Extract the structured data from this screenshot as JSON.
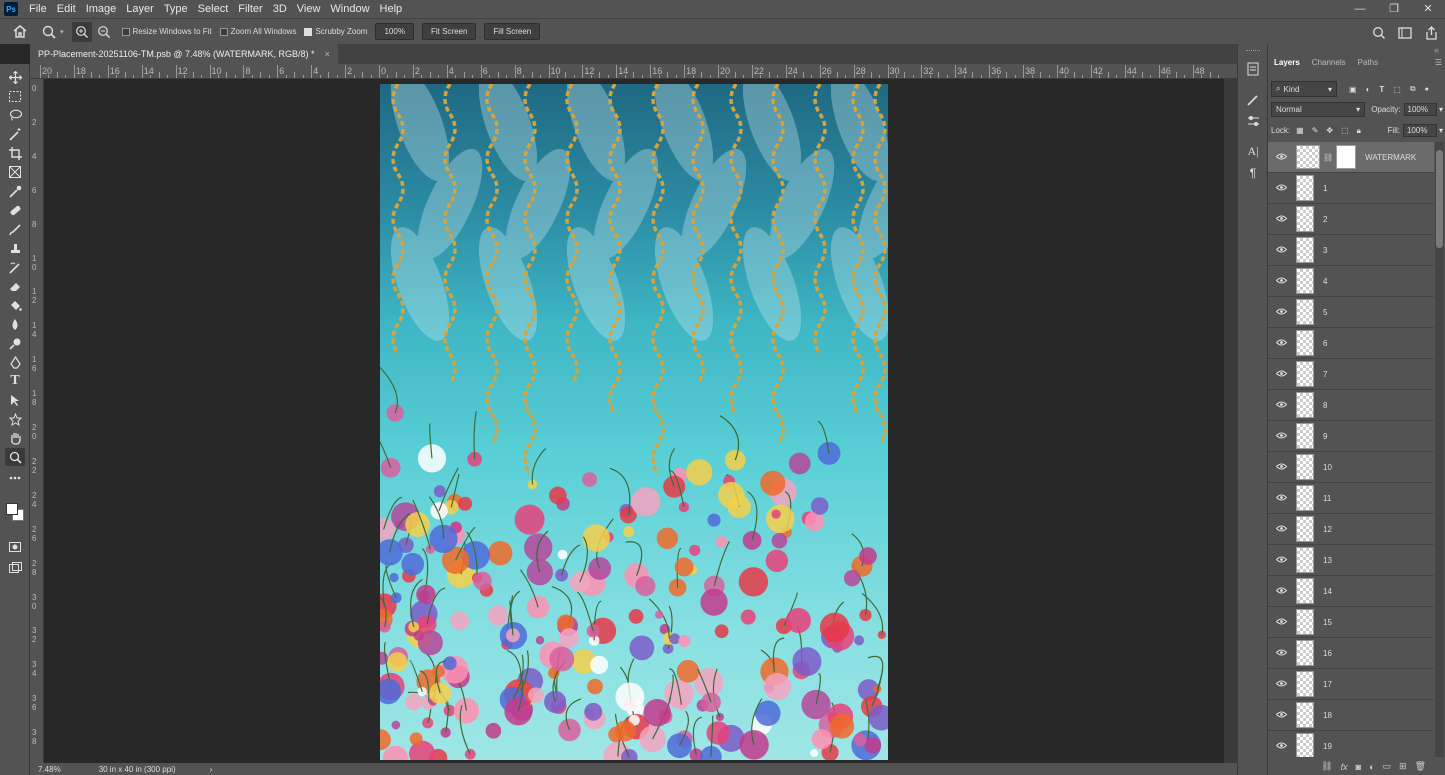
{
  "app": {
    "logo": "Ps"
  },
  "menu": [
    "File",
    "Edit",
    "Image",
    "Layer",
    "Type",
    "Select",
    "Filter",
    "3D",
    "View",
    "Window",
    "Help"
  ],
  "window_controls": [
    "—",
    "❐",
    "✕"
  ],
  "options_bar": {
    "resize_windows": "Resize Windows to Fit",
    "zoom_all": "Zoom All Windows",
    "scrubby": "Scrubby Zoom",
    "zoom_value": "100%",
    "fit_screen": "Fit Screen",
    "fill_screen": "Fill Screen",
    "resize_checked": false,
    "zoom_all_checked": false,
    "scrubby_checked": true
  },
  "document": {
    "tab_title": "PP-Placement-20251106-TM.psb @ 7.48% (WATERMARK, RGB/8) *",
    "close": "×"
  },
  "ruler": {
    "top_labels": [
      "20",
      "18",
      "16",
      "14",
      "12",
      "10",
      "8",
      "6",
      "4",
      "2",
      "0",
      "2",
      "4",
      "6",
      "8",
      "10",
      "12",
      "14",
      "16",
      "18",
      "20",
      "22",
      "24",
      "26",
      "28",
      "30",
      "32",
      "34",
      "36",
      "38",
      "40",
      "42",
      "44",
      "46",
      "48"
    ],
    "left_labels": [
      "0",
      "2",
      "4",
      "6",
      "8",
      "1 0",
      "1 2",
      "1 4",
      "1 6",
      "1 8",
      "2 0",
      "2 2",
      "2 4",
      "2 6",
      "2 8",
      "3 0",
      "3 2",
      "3 4",
      "3 6",
      "3 8"
    ]
  },
  "status": {
    "zoom": "7.48%",
    "doc_size": "30 in x 40 in (300 ppi)",
    "arrow": "›"
  },
  "panel": {
    "tabs": [
      "Layers",
      "Channels",
      "Paths"
    ],
    "kind": "Kind",
    "blend_mode": "Normal",
    "opacity_label": "Opacity:",
    "opacity": "100%",
    "lock_label": "Lock:",
    "fill_label": "Fill:",
    "fill": "100%",
    "layers": [
      "WATERMARK",
      "1",
      "2",
      "3",
      "4",
      "5",
      "6",
      "7",
      "8",
      "9",
      "10",
      "11",
      "12",
      "13",
      "14",
      "15",
      "16",
      "17",
      "18",
      "19"
    ]
  },
  "colors": {
    "ui": "#535353",
    "canvas_bg": "#282828",
    "selected_layer": "#6b6b6b"
  }
}
